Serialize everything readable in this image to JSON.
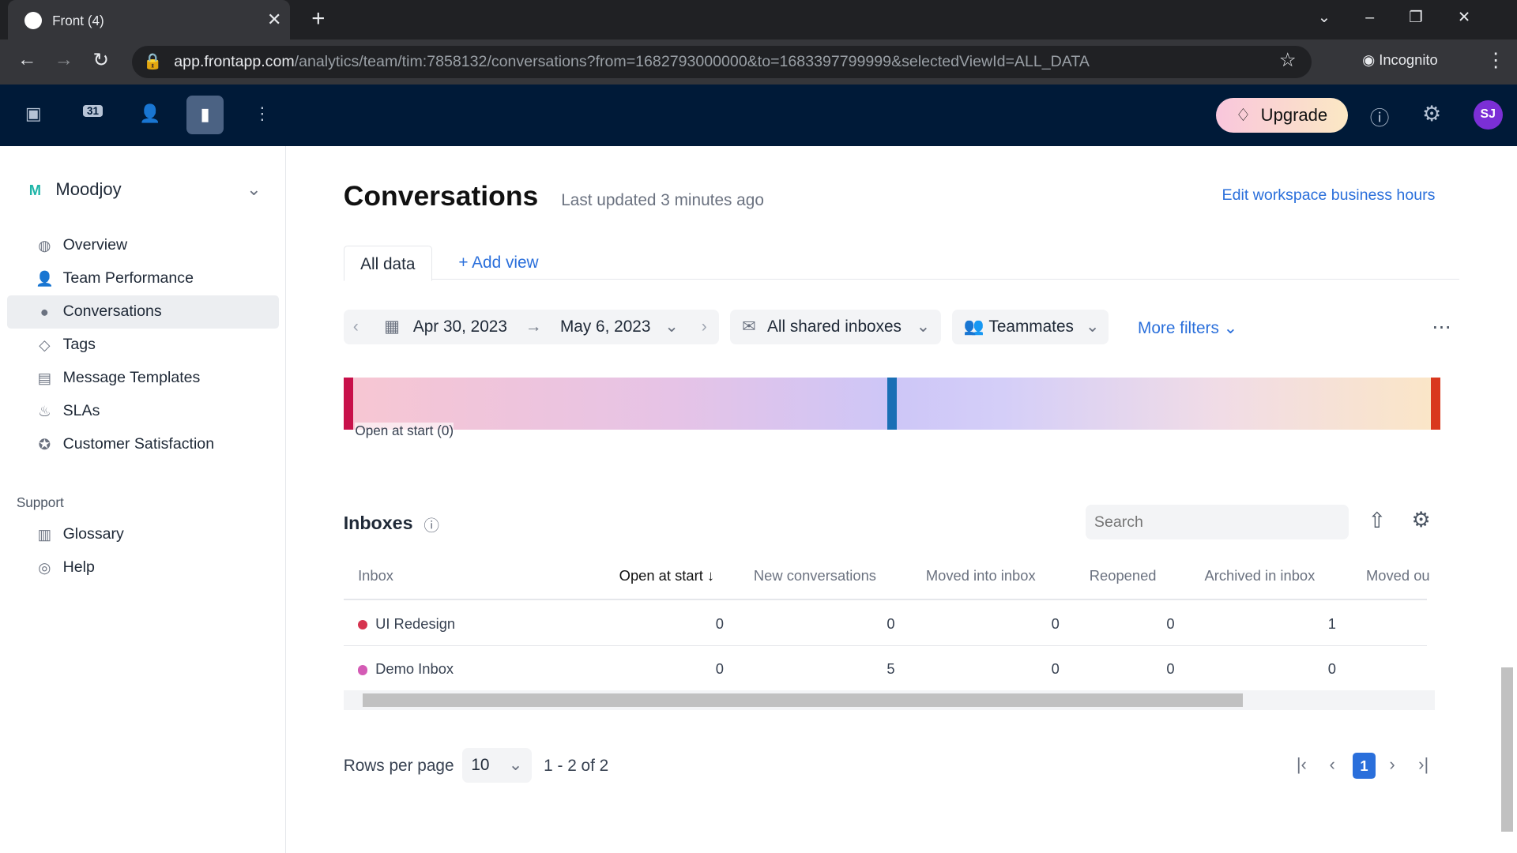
{
  "browser": {
    "tab_title": "Front (4)",
    "url_host": "app.frontapp.com",
    "url_path": "/analytics/team/tim:7858132/conversations?from=1682793000000&to=1683397799999&selectedViewId=ALL_DATA",
    "profile": "Incognito"
  },
  "appbar": {
    "upgrade": "Upgrade",
    "avatar": "SJ",
    "calendar_day": "31"
  },
  "sidebar": {
    "workspace_initial": "M",
    "workspace": "Moodjoy",
    "items": [
      {
        "label": "Overview",
        "icon": "globe-icon"
      },
      {
        "label": "Team Performance",
        "icon": "users-icon"
      },
      {
        "label": "Conversations",
        "icon": "chat-icon"
      },
      {
        "label": "Tags",
        "icon": "tag-icon"
      },
      {
        "label": "Message Templates",
        "icon": "template-icon"
      },
      {
        "label": "SLAs",
        "icon": "flame-icon"
      },
      {
        "label": "Customer Satisfaction",
        "icon": "star-icon"
      }
    ],
    "support_heading": "Support",
    "support": [
      {
        "label": "Glossary",
        "icon": "book-icon"
      },
      {
        "label": "Help",
        "icon": "lifebuoy-icon"
      }
    ]
  },
  "page": {
    "title": "Conversations",
    "updated": "Last updated 3 minutes ago",
    "edit_hours": "Edit workspace business hours",
    "tab_all": "All data",
    "add_view": "+ Add view"
  },
  "filters": {
    "from": "Apr 30, 2023",
    "to": "May 6, 2023",
    "inboxes": "All shared inboxes",
    "teammates": "Teammates",
    "more": "More filters"
  },
  "flow": {
    "label": "Open at start (0)",
    "colors": {
      "start": "#c8104a",
      "mid": "#1a6fb5",
      "end": "#d9381e"
    }
  },
  "inboxes": {
    "title": "Inboxes",
    "search_placeholder": "Search",
    "columns": [
      "Inbox",
      "Open at start ↓",
      "New conversations",
      "Moved into inbox",
      "Reopened",
      "Archived in inbox",
      "Moved ou"
    ],
    "rows": [
      {
        "name": "UI Redesign",
        "color": "#d6334f",
        "values": [
          "0",
          "0",
          "0",
          "0",
          "1"
        ]
      },
      {
        "name": "Demo Inbox",
        "color": "#d45bb5",
        "values": [
          "0",
          "5",
          "0",
          "0",
          "0"
        ]
      }
    ]
  },
  "pagination": {
    "rows_label": "Rows per page",
    "rows_value": "10",
    "range": "1 - 2 of 2",
    "page": "1"
  }
}
